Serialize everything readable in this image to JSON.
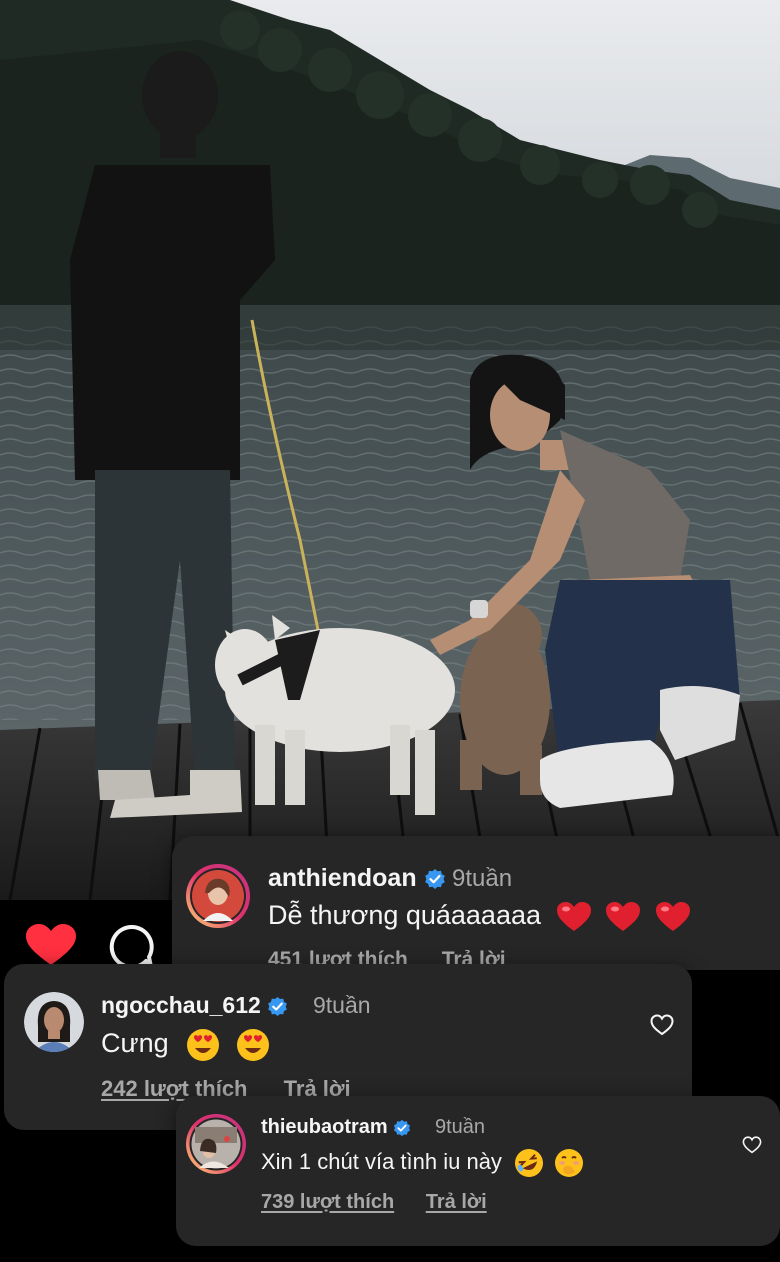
{
  "post": {
    "image_description_icon": "photo-scene",
    "like_icon": "heart-filled-icon",
    "comment_icon": "comment-bubble-icon"
  },
  "comments": [
    {
      "username": "anthiendoan",
      "verified": true,
      "time": "9tuần",
      "text": "Dễ thương quáaaaaaa",
      "emojis": [
        "red-heart",
        "red-heart",
        "red-heart"
      ],
      "likes": "451 lượt thích",
      "reply": "Trả lời"
    },
    {
      "username": "ngocchau_612",
      "verified": true,
      "time": "9tuần",
      "text": "Cưng",
      "emojis": [
        "heart-eyes",
        "heart-eyes"
      ],
      "likes": "242 lượt thích",
      "reply": "Trả lời"
    },
    {
      "username": "thieubaotram",
      "verified": true,
      "time": "9tuần",
      "text": "Xin 1 chút vía tình iu này",
      "emojis": [
        "rolling-laughing",
        "hand-over-mouth"
      ],
      "likes": "739 lượt thích",
      "reply": "Trả lời"
    }
  ],
  "colors": {
    "card_bg": "#262626",
    "verified_blue": "#3897f0",
    "like_red": "#ff3040",
    "story_ring": "#e1306c"
  }
}
